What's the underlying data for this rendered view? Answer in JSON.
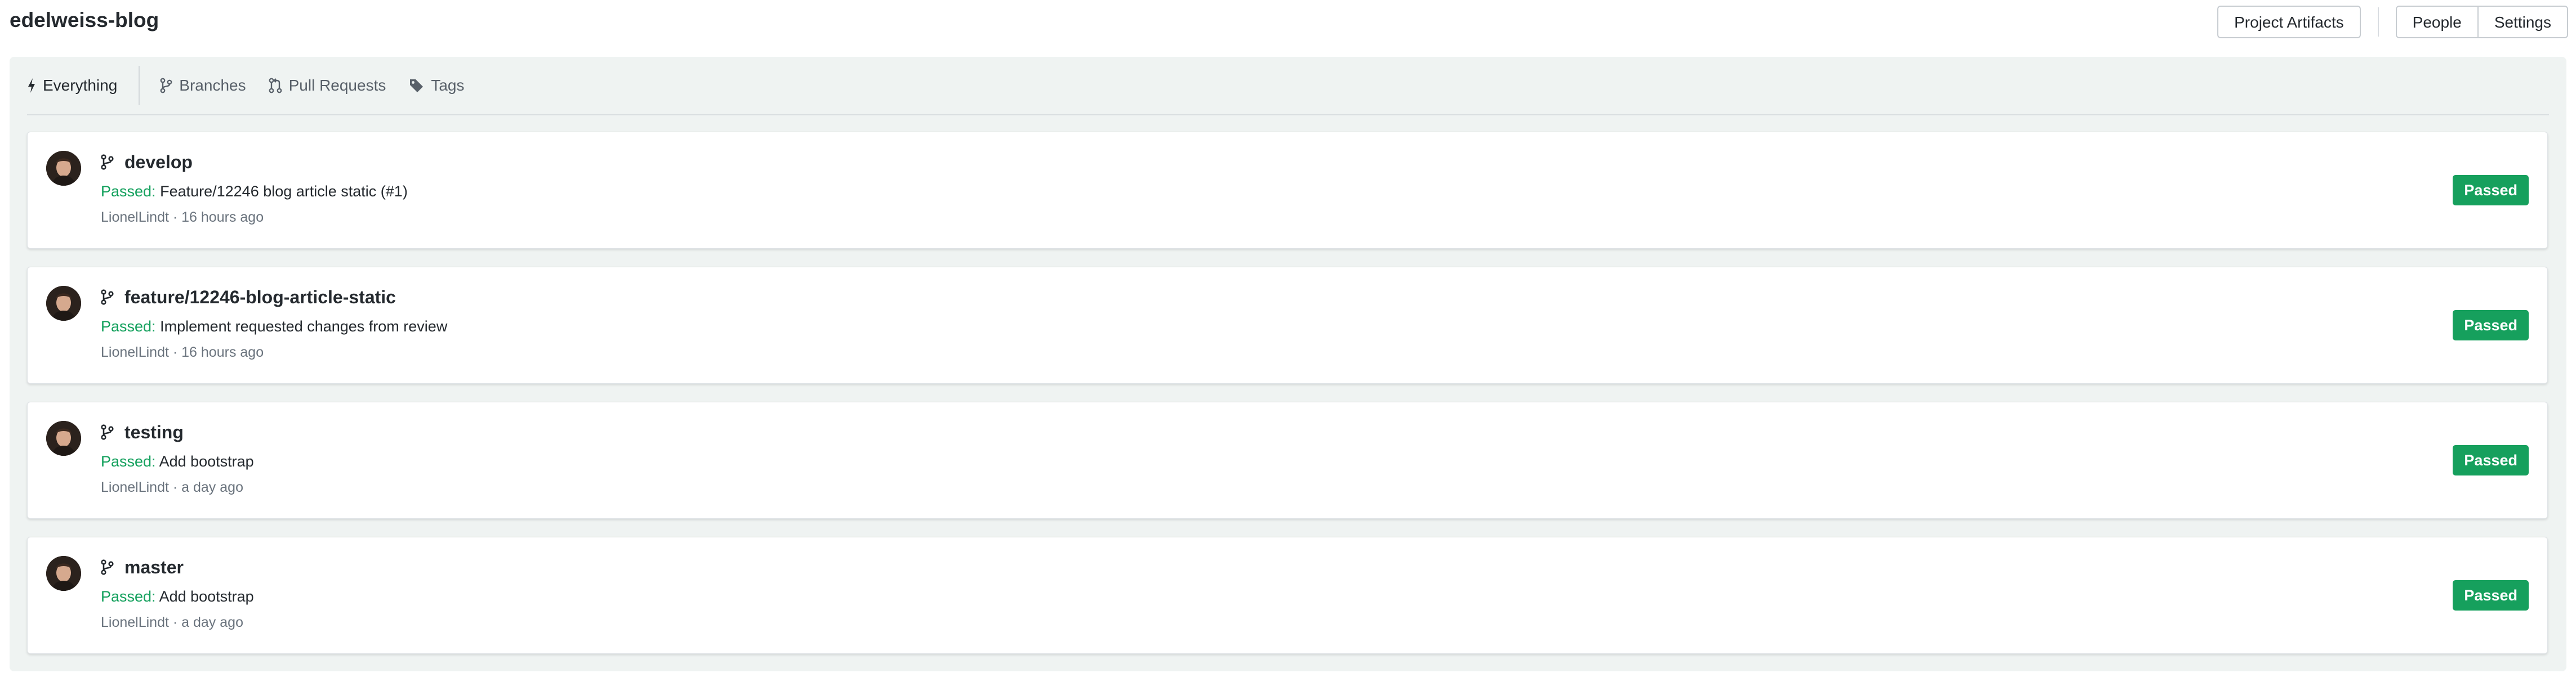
{
  "project": {
    "title": "edelweiss-blog"
  },
  "header": {
    "artifacts_label": "Project Artifacts",
    "people_label": "People",
    "settings_label": "Settings"
  },
  "tabs": [
    {
      "label": "Everything",
      "icon": "bolt-icon",
      "active": true
    },
    {
      "label": "Branches",
      "icon": "branch-icon",
      "active": false
    },
    {
      "label": "Pull Requests",
      "icon": "pull-request-icon",
      "active": false
    },
    {
      "label": "Tags",
      "icon": "tag-icon",
      "active": false
    }
  ],
  "builds": [
    {
      "branch": "develop",
      "status_prefix": "Passed:",
      "commit_message": "Feature/12246 blog article static (#1)",
      "meta": "LionelLindt · 16 hours ago",
      "badge": "Passed"
    },
    {
      "branch": "feature/12246-blog-article-static",
      "status_prefix": "Passed:",
      "commit_message": "Implement requested changes from review",
      "meta": "LionelLindt · 16 hours ago",
      "badge": "Passed"
    },
    {
      "branch": "testing",
      "status_prefix": "Passed:",
      "commit_message": "Add bootstrap",
      "meta": "LionelLindt · a day ago",
      "badge": "Passed"
    },
    {
      "branch": "master",
      "status_prefix": "Passed:",
      "commit_message": "Add bootstrap",
      "meta": "LionelLindt · a day ago",
      "badge": "Passed"
    }
  ],
  "colors": {
    "passed": "#16a05d",
    "panel_background": "#eff3f2"
  }
}
